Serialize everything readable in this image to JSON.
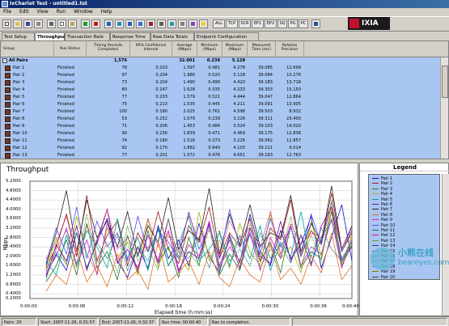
{
  "window": {
    "title": "IxChariot Test - untitled1.tst"
  },
  "menu": [
    "File",
    "Edit",
    "View",
    "Run",
    "Window",
    "Help"
  ],
  "toolbar": {
    "text_buttons": [
      "ALL",
      "TCP",
      "SCR",
      "EP1",
      "EP2",
      "SQ",
      "PG",
      "PC"
    ],
    "logo_text": "IXIA",
    "icons": [
      "new-icon",
      "open-icon",
      "save-icon",
      "print-icon",
      "cut-icon",
      "copy-icon",
      "paste-icon",
      "run-icon",
      "stop-icon",
      "pair-icon",
      "multicast-icon",
      "app-group-icon",
      "edit-icon",
      "delete-icon",
      "script-icon",
      "chart-icon",
      "sort-icon",
      "filter-icon",
      "help-icon",
      "info-icon"
    ]
  },
  "tabs": [
    "Test Setup",
    "Throughput",
    "Transaction Rate",
    "Response Time",
    "Raw Data Totals",
    "Endpoint Configuration"
  ],
  "active_tab": "Throughput",
  "grid": {
    "columns": [
      "Group",
      "Run Status",
      "Timing Records\nCompleted",
      "95% Confidence\nInterval",
      "Average\n(Mbps)",
      "Minimum\n(Mbps)",
      "Maximum\n(Mbps)",
      "Measured\nTime (sec)",
      "Relative\nPrecision"
    ],
    "summary": {
      "name": "All Pairs",
      "records": "1,576",
      "average": "32.001",
      "minimum": "0.239",
      "maximum": "5.128"
    },
    "rows": [
      {
        "name": "Pair 1",
        "status": "Finished",
        "records": "78",
        "ci": "0.203",
        "avg": "1.597",
        "min": "0.481",
        "max": "4.278",
        "time": "39.085",
        "prec": "12.699"
      },
      {
        "name": "Pair 2",
        "status": "Finished",
        "records": "97",
        "ci": "0.204",
        "avg": "1.986",
        "min": "0.520",
        "max": "5.128",
        "time": "39.084",
        "prec": "10.276"
      },
      {
        "name": "Pair 3",
        "status": "Finished",
        "records": "73",
        "ci": "0.204",
        "avg": "1.490",
        "min": "0.499",
        "max": "4.420",
        "time": "39.183",
        "prec": "13.716"
      },
      {
        "name": "Pair 4",
        "status": "Finished",
        "records": "80",
        "ci": "0.247",
        "avg": "1.628",
        "min": "0.335",
        "max": "4.233",
        "time": "39.303",
        "prec": "15.150"
      },
      {
        "name": "Pair 5",
        "status": "Finished",
        "records": "77",
        "ci": "0.203",
        "avg": "1.579",
        "min": "0.521",
        "max": "4.444",
        "time": "39.047",
        "prec": "12.864"
      },
      {
        "name": "Pair 6",
        "status": "Finished",
        "records": "75",
        "ci": "0.213",
        "avg": "1.535",
        "min": "0.445",
        "max": "4.211",
        "time": "39.091",
        "prec": "13.905"
      },
      {
        "name": "Pair 7",
        "status": "Finished",
        "records": "100",
        "ci": "0.180",
        "avg": "2.025",
        "min": "0.761",
        "max": "4.598",
        "time": "39.503",
        "prec": "8.932"
      },
      {
        "name": "Pair 8",
        "status": "Finished",
        "records": "53",
        "ci": "0.252",
        "avg": "1.079",
        "min": "0.239",
        "max": "3.226",
        "time": "39.311",
        "prec": "23.400"
      },
      {
        "name": "Pair 9",
        "status": "Finished",
        "records": "71",
        "ci": "0.206",
        "avg": "1.453",
        "min": "0.484",
        "max": "3.524",
        "time": "39.103",
        "prec": "14.020"
      },
      {
        "name": "Pair 10",
        "status": "Finished",
        "records": "90",
        "ci": "0.236",
        "avg": "1.839",
        "min": "0.471",
        "max": "4.469",
        "time": "39.175",
        "prec": "12.838"
      },
      {
        "name": "Pair 11",
        "status": "Finished",
        "records": "74",
        "ci": "0.180",
        "avg": "1.516",
        "min": "0.373",
        "max": "3.226",
        "time": "39.062",
        "prec": "11.857"
      },
      {
        "name": "Pair 12",
        "status": "Finished",
        "records": "92",
        "ci": "0.170",
        "avg": "1.882",
        "min": "0.640",
        "max": "4.103",
        "time": "39.111",
        "prec": "9.014"
      },
      {
        "name": "Pair 13",
        "status": "Finished",
        "records": "77",
        "ci": "0.201",
        "avg": "1.572",
        "min": "0.478",
        "max": "4.651",
        "time": "39.193",
        "prec": "12.763"
      }
    ]
  },
  "chart": {
    "title": "Throughput",
    "ylabel": "Mbps",
    "xlabel": "Elapsed time (h:mm:ss)"
  },
  "chart_data": {
    "type": "line",
    "title": "Throughput",
    "xlabel": "Elapsed time (h:mm:ss)",
    "ylabel": "Mbps",
    "ylim": [
      0.2,
      5.2
    ],
    "yticks": [
      "5.2000",
      "4.8000",
      "4.4000",
      "4.0000",
      "3.6000",
      "3.2000",
      "2.8000",
      "2.4000",
      "2.0000",
      "1.6000",
      "1.2000",
      "0.8000",
      "0.4000",
      "0.2000"
    ],
    "xticks": [
      "0:00:00",
      "0:00:06",
      "0:00:12",
      "0:00:18",
      "0:00:24",
      "0:00:30",
      "0:00:36",
      "0:00:40"
    ],
    "xlim_sec": [
      0,
      40
    ],
    "grid": true,
    "legend": "right panel",
    "series": [
      {
        "name": "Pair 1",
        "color": "#1010c0",
        "values": [
          1.2,
          2.1,
          1.4,
          3.0,
          1.5,
          2.6,
          3.6,
          1.8,
          1.1,
          2.4,
          1.5,
          3.3,
          1.9,
          2.7,
          1.6,
          3.4,
          2.0,
          1.3,
          2.9,
          1.7,
          3.8,
          2.2,
          1.6,
          3.1,
          1.9,
          2.5,
          3.7,
          1.5,
          2.8,
          4.2,
          1.8
        ]
      },
      {
        "name": "Pair 2",
        "color": "#a01818",
        "values": [
          1.5,
          2.4,
          3.8,
          2.0,
          4.6,
          1.8,
          2.9,
          3.5,
          1.6,
          3.0,
          2.2,
          3.9,
          2.3,
          1.7,
          3.3,
          2.6,
          4.1,
          1.9,
          3.0,
          2.4,
          3.6,
          1.8,
          3.2,
          2.7,
          4.4,
          2.0,
          3.1,
          2.5,
          4.7,
          2.2,
          3.0
        ]
      },
      {
        "name": "Pair 3",
        "color": "#207820",
        "values": [
          0.9,
          1.6,
          2.7,
          1.2,
          3.4,
          1.5,
          2.2,
          1.0,
          2.9,
          1.3,
          3.1,
          1.7,
          2.4,
          1.1,
          2.8,
          1.6,
          3.5,
          1.2,
          2.1,
          1.4,
          3.0,
          1.8,
          2.6,
          1.3,
          3.3,
          1.5,
          2.2,
          1.9,
          3.9,
          1.6,
          2.5
        ]
      },
      {
        "name": "Pair 4",
        "color": "#b0b010",
        "values": [
          1.4,
          2.8,
          1.6,
          3.7,
          2.1,
          1.3,
          3.2,
          1.9,
          2.6,
          1.2,
          3.6,
          1.5,
          2.9,
          2.0,
          1.4,
          3.9,
          1.8,
          2.7,
          1.5,
          3.4,
          2.2,
          1.6,
          3.8,
          1.9,
          2.4,
          1.3,
          3.5,
          2.0,
          4.0,
          1.7,
          2.9
        ]
      },
      {
        "name": "Pair 5",
        "color": "#00a0a0",
        "values": [
          1.8,
          1.2,
          2.9,
          1.7,
          3.1,
          2.4,
          1.5,
          3.6,
          1.9,
          2.8,
          1.4,
          3.2,
          1.6,
          2.5,
          3.7,
          1.8,
          2.3,
          3.0,
          1.6,
          2.9,
          1.9,
          3.3,
          1.4,
          2.6,
          2.0,
          3.9,
          1.7,
          2.8,
          3.5,
          1.9,
          2.6
        ]
      },
      {
        "name": "Pair 6",
        "color": "#8000a0",
        "values": [
          1.1,
          2.5,
          1.8,
          3.3,
          1.4,
          2.7,
          4.0,
          1.7,
          2.3,
          1.5,
          2.9,
          1.8,
          3.6,
          1.4,
          2.2,
          1.9,
          3.4,
          1.6,
          2.7,
          1.5,
          3.2,
          2.0,
          1.7,
          3.5,
          1.8,
          2.9,
          1.6,
          3.3,
          4.1,
          1.8,
          2.4
        ]
      },
      {
        "name": "Pair 7",
        "color": "#202020",
        "values": [
          1.6,
          3.0,
          4.8,
          2.2,
          4.4,
          2.8,
          3.5,
          2.4,
          3.9,
          2.0,
          3.3,
          2.6,
          4.5,
          2.3,
          3.1,
          2.7,
          4.9,
          2.1,
          3.8,
          2.5,
          4.2,
          2.4,
          3.0,
          2.8,
          4.6,
          2.2,
          3.4,
          2.6,
          5.0,
          2.3,
          3.3
        ]
      },
      {
        "name": "Pair 8",
        "color": "#e07020",
        "values": [
          0.5,
          1.2,
          0.8,
          2.3,
          0.9,
          1.6,
          0.7,
          2.1,
          1.0,
          1.4,
          0.6,
          2.6,
          0.9,
          1.3,
          1.8,
          0.8,
          2.2,
          1.1,
          0.7,
          1.9,
          1.2,
          0.9,
          2.5,
          1.0,
          1.5,
          0.8,
          2.0,
          1.3,
          3.0,
          1.0,
          1.6
        ]
      },
      {
        "name": "Pair 9",
        "color": "#d020d0",
        "values": [
          1.3,
          2.0,
          3.2,
          1.6,
          2.7,
          1.2,
          3.4,
          1.8,
          2.3,
          1.4,
          2.9,
          1.7,
          3.1,
          1.3,
          2.5,
          2.0,
          3.5,
          1.5,
          2.4,
          1.8,
          3.0,
          1.4,
          2.8,
          1.9,
          3.3,
          1.6,
          2.4,
          2.1,
          3.6,
          1.5,
          2.7
        ]
      },
      {
        "name": "Pair 10",
        "color": "#5050f0",
        "values": [
          1.7,
          3.2,
          2.1,
          4.1,
          1.9,
          3.5,
          2.4,
          3.0,
          1.8,
          3.7,
          2.2,
          3.1,
          2.6,
          1.9,
          3.9,
          2.3,
          3.3,
          1.9,
          4.0,
          2.4,
          2.9,
          2.1,
          3.6,
          2.4,
          3.2,
          2.0,
          3.8,
          2.5,
          4.3,
          2.2,
          3.1
        ]
      },
      {
        "name": "Pair 11",
        "color": "#107070",
        "values": [
          1.4,
          2.2,
          1.7,
          3.0,
          1.5,
          2.6,
          1.9,
          2.9,
          1.4,
          2.4,
          1.8,
          3.2,
          1.6,
          2.2,
          1.9,
          2.8,
          1.5,
          3.1,
          1.8,
          2.3,
          1.6,
          3.0,
          1.9,
          2.5,
          1.7,
          2.9,
          2.0,
          3.2,
          2.3,
          1.8,
          2.6
        ]
      },
      {
        "name": "Pair 12",
        "color": "#d02060",
        "values": [
          1.9,
          2.6,
          3.7,
          2.0,
          3.3,
          2.5,
          4.0,
          2.3,
          2.8,
          2.1,
          3.6,
          2.4,
          3.0,
          2.2,
          3.8,
          2.6,
          3.1,
          2.0,
          3.5,
          2.7,
          3.2,
          2.4,
          3.9,
          2.1,
          3.4,
          2.5,
          3.0,
          2.8,
          4.1,
          2.3,
          3.2
        ]
      },
      {
        "name": "Pair 13",
        "color": "#60a030",
        "values": [
          1.0,
          2.3,
          3.1,
          1.5,
          3.8,
          1.7,
          2.6,
          1.3,
          3.3,
          1.8,
          2.4,
          1.4,
          3.6,
          1.9,
          2.2,
          1.6,
          3.2,
          1.4,
          2.8,
          1.7,
          3.4,
          1.5,
          2.3,
          2.0,
          3.7,
          1.6,
          2.9,
          1.8,
          4.4,
          1.6,
          2.8
        ]
      }
    ]
  },
  "legend": {
    "title": "Legend",
    "items": [
      {
        "label": "Pair 1",
        "color": "#1010c0"
      },
      {
        "label": "Pair 2",
        "color": "#a01818"
      },
      {
        "label": "Pair 3",
        "color": "#207820"
      },
      {
        "label": "Pair 4",
        "color": "#b0b010"
      },
      {
        "label": "Pair 5",
        "color": "#00a0a0"
      },
      {
        "label": "Pair 6",
        "color": "#8000a0"
      },
      {
        "label": "Pair 7",
        "color": "#202020"
      },
      {
        "label": "Pair 8",
        "color": "#e07020"
      },
      {
        "label": "Pair 9",
        "color": "#d020d0"
      },
      {
        "label": "Pair 10",
        "color": "#5050f0"
      },
      {
        "label": "Pair 11",
        "color": "#107070"
      },
      {
        "label": "Pair 12",
        "color": "#d02060"
      },
      {
        "label": "Pair 13",
        "color": "#60a030"
      },
      {
        "label": "Pair 14",
        "color": "#303090"
      },
      {
        "label": "Pair 15",
        "color": "#906030"
      },
      {
        "label": "Pair 16",
        "color": "#309090"
      },
      {
        "label": "Pair 17",
        "color": "#c06060"
      },
      {
        "label": "Pair 18",
        "color": "#6060c0"
      },
      {
        "label": "Pair 19",
        "color": "#808000"
      },
      {
        "label": "Pair 20",
        "color": "#404040"
      }
    ]
  },
  "watermark": {
    "cn": "小熊在线",
    "en": "beareyes.com"
  },
  "status": {
    "pairs": "Pairs: 20",
    "start": "Start: 2007-11-26, 0:31:57",
    "end": "End: 2007-11-26, 0:32:37",
    "runtime": "Run time: 00:00:40",
    "state": "Ran to completion"
  }
}
